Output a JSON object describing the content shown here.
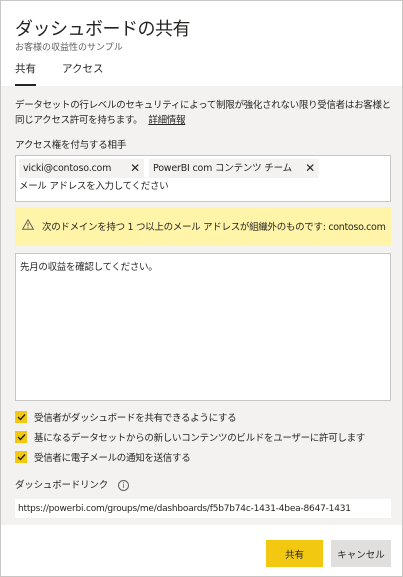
{
  "dialog": {
    "title": "ダッシュボードの共有",
    "subtitle": "お客様の収益性のサンプル"
  },
  "tabs": [
    {
      "label": "共有",
      "active": true
    },
    {
      "label": "アクセス",
      "active": false
    }
  ],
  "description": {
    "text": "データセットの行レベルのセキュリティによって制限が強化されない限り受信者はお客様と同じアクセス許可を持ちます。",
    "link": "詳細情報"
  },
  "recipients": {
    "label": "アクセス権を付与する相手",
    "chips": [
      "vicki@contoso.com",
      "PowerBI com コンテンツ チーム"
    ],
    "remove_glyph": "✕",
    "input_placeholder": "メール アドレスを入力してください"
  },
  "warning": {
    "icon": "warning-icon",
    "text": "次のドメインを持つ 1 つ以上のメール アドレスが組織外のものです: contoso.com"
  },
  "message": {
    "value": "先月の収益を確認してください。"
  },
  "options": [
    {
      "label": "受信者がダッシュボードを共有できるようにする",
      "checked": true
    },
    {
      "label": "基になるデータセットからの新しいコンテンツのビルドをユーザーに許可します",
      "checked": true
    },
    {
      "label": "受信者に電子メールの通知を送信する",
      "checked": true
    }
  ],
  "dashboard_link": {
    "label": "ダッシュボードリンク",
    "info_glyph": "i",
    "value": "https://powerbi.com/groups/me/dashboards/f5b7b74c-1431-4bea-8647-1431"
  },
  "buttons": {
    "share": "共有",
    "cancel": "キャンセル"
  },
  "colors": {
    "accent": "#f2c811",
    "warning_bg": "#fff4a8",
    "panel_bg": "#f3f2f1"
  }
}
